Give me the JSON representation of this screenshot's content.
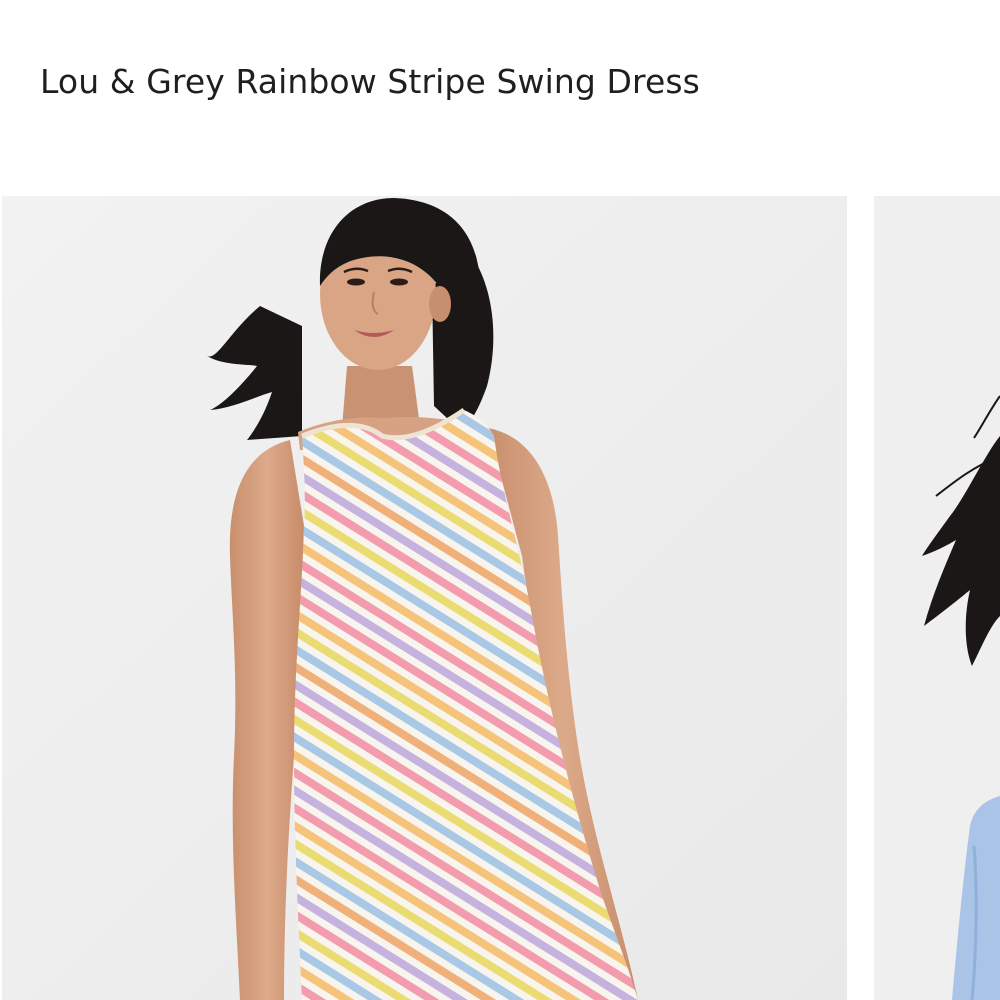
{
  "product": {
    "title": "Lou & Grey Rainbow Stripe Swing Dress"
  },
  "gallery": {
    "images": [
      {
        "alt": "Model in rainbow stripe sleeveless swing dress"
      },
      {
        "alt": "Model in blue top"
      }
    ]
  },
  "colors": {
    "background": "#ffffff",
    "photo_backdrop": "#efefef",
    "hair": "#1b1717",
    "skin": "#d8a686",
    "dress_base": "#f7f3ec",
    "stripes": [
      "#f29cae",
      "#f5c37a",
      "#eadc72",
      "#a9c8e6",
      "#f0b07a",
      "#c5b2de"
    ]
  }
}
